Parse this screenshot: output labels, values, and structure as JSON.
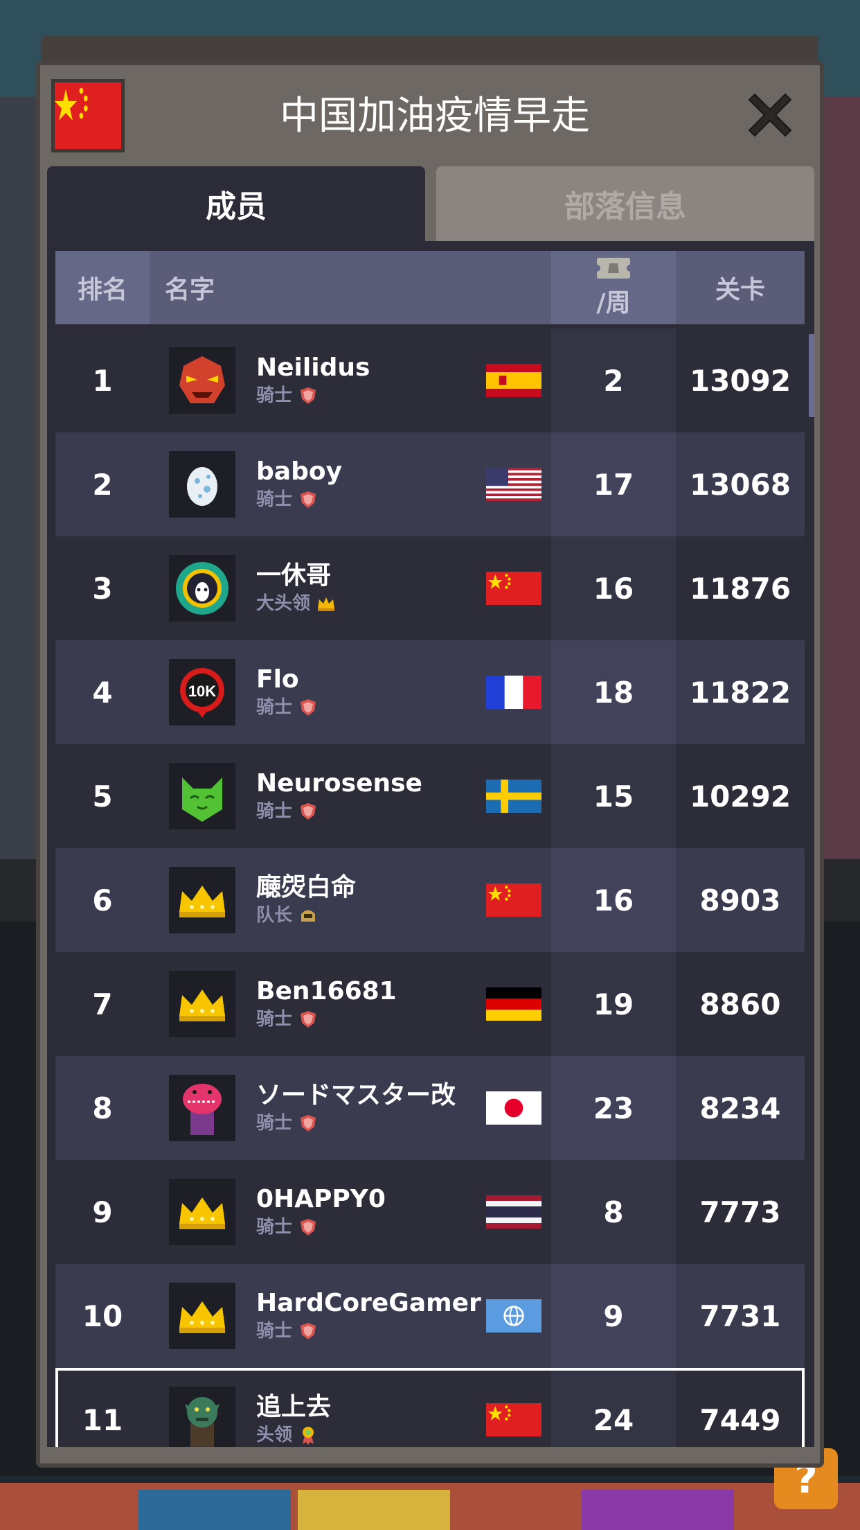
{
  "dialog": {
    "title": "中国加油疫情早走",
    "close_icon": "close-x-icon",
    "clan_flag": "china"
  },
  "tabs": [
    {
      "label": "成员",
      "active": true
    },
    {
      "label": "部落信息",
      "active": false
    }
  ],
  "table": {
    "headers": {
      "rank": "排名",
      "name": "名字",
      "tickets": "/周",
      "level": "关卡"
    },
    "rows": [
      {
        "rank": "1",
        "name": "Neilidus",
        "role": "骑士",
        "role_icon": "shield",
        "flag": "spain",
        "tickets": "2",
        "level": "13092",
        "avatar": "demon"
      },
      {
        "rank": "2",
        "name": "baboy",
        "role": "骑士",
        "role_icon": "shield",
        "flag": "usa",
        "tickets": "17",
        "level": "13068",
        "avatar": "egg"
      },
      {
        "rank": "3",
        "name": "一休哥",
        "role": "大头领",
        "role_icon": "crown",
        "flag": "china",
        "tickets": "16",
        "level": "11876",
        "avatar": "gear"
      },
      {
        "rank": "4",
        "name": "Flo",
        "role": "骑士",
        "role_icon": "shield",
        "flag": "france",
        "tickets": "18",
        "level": "11822",
        "avatar": "10k"
      },
      {
        "rank": "5",
        "name": "Neurosense",
        "role": "骑士",
        "role_icon": "shield",
        "flag": "sweden",
        "tickets": "15",
        "level": "10292",
        "avatar": "green-cat"
      },
      {
        "rank": "6",
        "name": "廰焈白命",
        "role": "队长",
        "role_icon": "helmet",
        "flag": "china",
        "tickets": "16",
        "level": "8903",
        "avatar": "crown"
      },
      {
        "rank": "7",
        "name": "Ben16681",
        "role": "骑士",
        "role_icon": "shield",
        "flag": "germany",
        "tickets": "19",
        "level": "8860",
        "avatar": "crown"
      },
      {
        "rank": "8",
        "name": "ソードマスター改",
        "role": "骑士",
        "role_icon": "shield",
        "flag": "japan",
        "tickets": "23",
        "level": "8234",
        "avatar": "pink-monster"
      },
      {
        "rank": "9",
        "name": "0HAPPY0",
        "role": "骑士",
        "role_icon": "shield",
        "flag": "thailand",
        "tickets": "8",
        "level": "7773",
        "avatar": "crown"
      },
      {
        "rank": "10",
        "name": "HardCoreGamer",
        "role": "骑士",
        "role_icon": "shield",
        "flag": "globe",
        "tickets": "9",
        "level": "7731",
        "avatar": "crown"
      },
      {
        "rank": "11",
        "name": "追上去",
        "role": "头领",
        "role_icon": "medal",
        "flag": "china",
        "tickets": "24",
        "level": "7449",
        "avatar": "orc",
        "self": true
      }
    ]
  },
  "help_button": {
    "label": "?"
  }
}
